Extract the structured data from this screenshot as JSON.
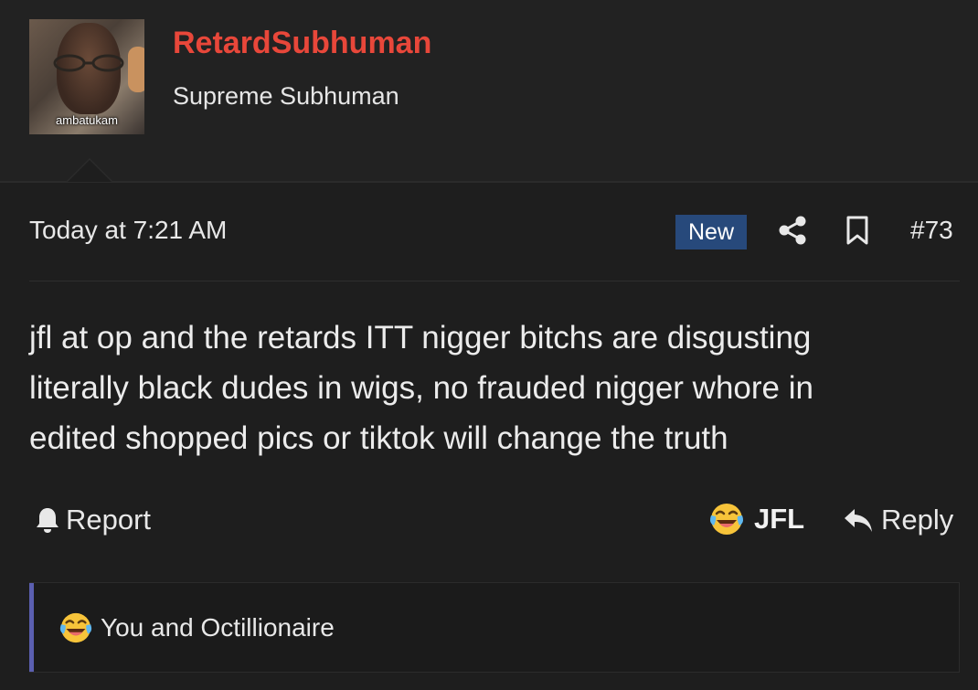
{
  "user": {
    "username": "RetardSubhuman",
    "title": "Supreme Subhuman",
    "avatar_caption": "ambatukam",
    "username_color": "#e8473a"
  },
  "post": {
    "time": "Today at 7:21 AM",
    "badge": "New",
    "number": "#73",
    "lines": [
      "jfl at op and the retards ITT nigger bitchs are disgusting",
      "literally black dudes in wigs, no frauded nigger whore in",
      "edited shopped pics or tiktok will change the truth"
    ],
    "icons": {
      "share": "share-icon",
      "bookmark": "bookmark-icon"
    }
  },
  "actions": {
    "report_label": "Report",
    "react_label": "JFL",
    "reply_label": "Reply",
    "react_emoji": "crying-laughing-emoji-icon"
  },
  "reactions": {
    "summary": "You and Octillionaire",
    "emoji": "crying-laughing-emoji-icon"
  },
  "colors": {
    "background": "#1e1e1e",
    "badge": "#27497b",
    "reaction_accent": "#5b5fb0"
  }
}
